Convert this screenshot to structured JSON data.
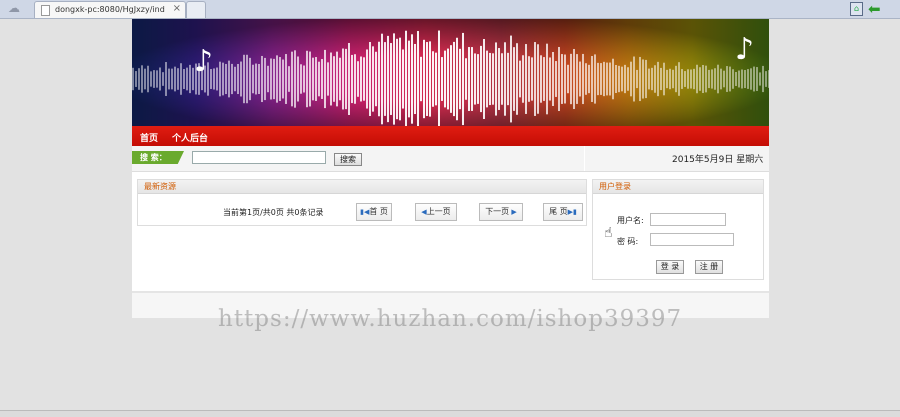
{
  "browser": {
    "tab_title": "dongxk-pc:8080/HgJxzy/ind",
    "tab_close": "×"
  },
  "nav": {
    "home": "首页",
    "personal": "个人后台"
  },
  "search": {
    "label": "搜 索：",
    "button": "搜索",
    "date": "2015年5月9日 星期六"
  },
  "latest": {
    "title": "最新资源",
    "info": "当前第1页/共0页  共0条记录",
    "first": "首 页",
    "prev": "上一页",
    "next": "下一页",
    "last": "尾 页"
  },
  "login": {
    "title": "用户登录",
    "username_label": "用户名:",
    "password_label": "密   码:",
    "login_button": "登 录",
    "register_button": "注 册"
  },
  "watermark": "https://www.huzhan.com/ishop39397"
}
